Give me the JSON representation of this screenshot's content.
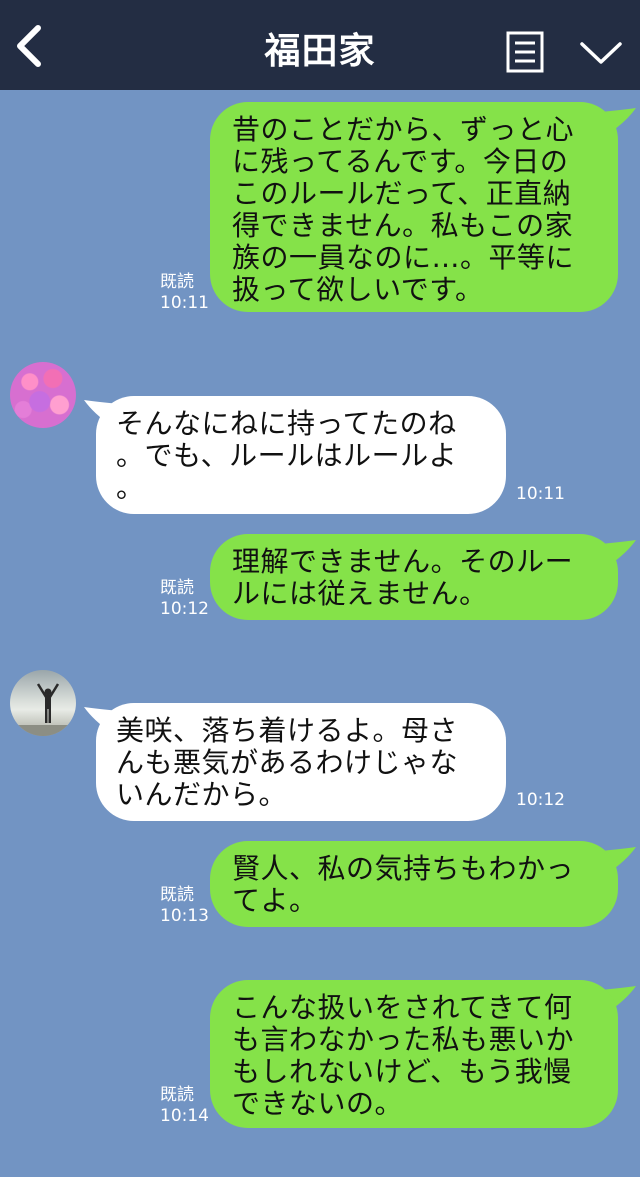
{
  "header": {
    "title": "福田家"
  },
  "messages": [
    {
      "side": "out",
      "text": "昔のことだから、ずっと心\nに残ってるんです。今日の\nこのルールだって、正直納\n得できません。私もこの家\n族の一員なのに…。平等に\n扱って欲しいです。",
      "read": "既読",
      "time": "10:11"
    },
    {
      "side": "in",
      "avatar": "flower-avatar",
      "text": "そんなにねに持ってたのね\n。でも、ルールはルールよ\n。",
      "time": "10:11"
    },
    {
      "side": "out",
      "text": "理解できません。そのルー\nルには従えません。",
      "read": "既読",
      "time": "10:12"
    },
    {
      "side": "in",
      "avatar": "person-avatar",
      "text": "美咲、落ち着けるよ。母さ\nんも悪気があるわけじゃな\nいんだから。",
      "time": "10:12"
    },
    {
      "side": "out",
      "text": "賢人、私の気持ちもわかっ\nてよ。",
      "read": "既読",
      "time": "10:13"
    },
    {
      "side": "out",
      "text": "こんな扱いをされてきて何\nも言わなかった私も悪いか\nもしれないけど、もう我慢\nできないの。",
      "read": "既読",
      "time": "10:14"
    }
  ],
  "colors": {
    "header_bg": "#232d43",
    "chat_bg": "#7294c3",
    "outgoing_bubble": "#85e249",
    "incoming_bubble": "#ffffff"
  }
}
